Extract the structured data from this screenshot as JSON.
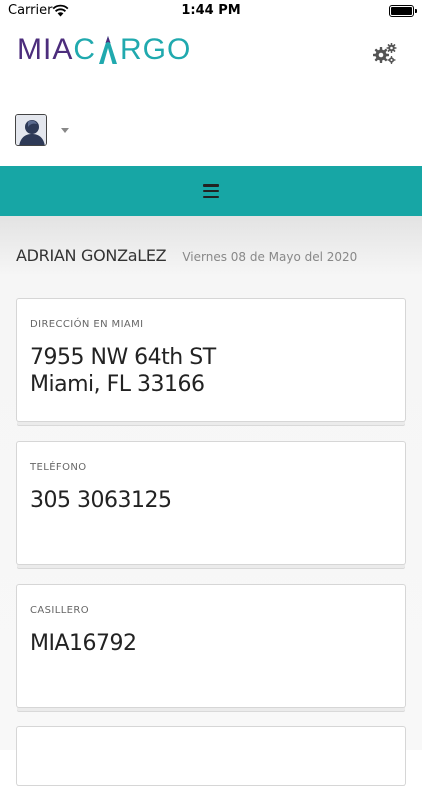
{
  "status_bar": {
    "carrier": "Carrier",
    "time": "1:44 PM"
  },
  "brand": {
    "logo_left": "MIA",
    "logo_a": "A",
    "logo_right": "CARGO",
    "colors": {
      "purple": "#4c2d7c",
      "teal": "#20a9ae"
    }
  },
  "header": {
    "settings_icon": "gears-icon",
    "avatar_icon": "user-avatar-icon",
    "menu_caret_icon": "caret-down-icon"
  },
  "navbar": {
    "menu_icon": "hamburger-icon",
    "color": "#17a6a5"
  },
  "profile": {
    "name": "ADRIAN GONZaLEZ",
    "date": "Viernes 08 de Mayo del 2020"
  },
  "cards": [
    {
      "label": "DIRECCIÓN EN MIAMI",
      "line1": "7955 NW 64th ST",
      "line2": "Miami, FL 33166"
    },
    {
      "label": "TELÉFONO",
      "value": "305 3063125"
    },
    {
      "label": "CASILLERO",
      "value": "MIA16792"
    }
  ]
}
